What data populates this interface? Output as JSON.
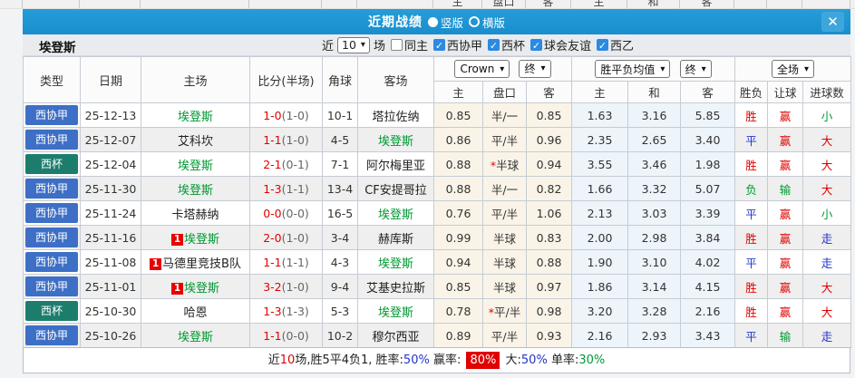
{
  "colors": {
    "title_bar": "#1a8ecd",
    "league_badge_blue": "#3e6fc6",
    "cup_badge_teal": "#1c7d6d",
    "win_red": "#e10000",
    "draw_blue": "#2233cc",
    "lose_green": "#009933",
    "team_green": "#009933",
    "odds_col_bg": "#faf4e8",
    "avg_col_bg": "#edf4fa"
  },
  "top_strip": {
    "labels": [
      "主",
      "盘口",
      "客",
      "主",
      "和",
      "客"
    ]
  },
  "titlebar": {
    "title": "近期战绩",
    "options": [
      {
        "label": "竖版",
        "selected": true
      },
      {
        "label": "横版",
        "selected": false
      }
    ],
    "close_label": "✕"
  },
  "filter": {
    "team": "埃登斯",
    "near_label": "近",
    "count_value": "10",
    "games_label": "场",
    "same_home_label": "同主",
    "leagues": [
      "西协甲",
      "西杯",
      "球会友谊",
      "西乙"
    ]
  },
  "table": {
    "selects": {
      "bookmaker": "Crown",
      "bookmaker_state": "终",
      "avg_type": "胜平负均值",
      "avg_state": "终",
      "scope": "全场"
    },
    "columns": [
      "类型",
      "日期",
      "主场",
      "比分(半场)",
      "角球",
      "客场",
      "主",
      "盘口",
      "客",
      "主",
      "和",
      "客",
      "胜负",
      "让球",
      "进球数"
    ],
    "rows": [
      {
        "league": {
          "text": "西协甲",
          "type": "lga"
        },
        "date": "25-12-13",
        "home": {
          "text": "埃登斯",
          "green": true,
          "badge": null
        },
        "score": {
          "full": "1-0",
          "half": "(1-0)"
        },
        "corner": "10-1",
        "away": {
          "text": "塔拉佐纳",
          "green": false
        },
        "odds": {
          "home": "0.85",
          "handicap": "半/一",
          "star": false,
          "away": "0.85"
        },
        "avg": [
          "1.63",
          "3.16",
          "5.85"
        ],
        "result": {
          "text": "胜",
          "color": "red"
        },
        "handicap_result": {
          "text": "赢",
          "color": "red"
        },
        "goals": {
          "text": "小",
          "color": "green"
        }
      },
      {
        "league": {
          "text": "西协甲",
          "type": "lga"
        },
        "date": "25-12-07",
        "home": {
          "text": "艾科坎",
          "green": false,
          "badge": null
        },
        "score": {
          "full": "1-1",
          "half": "(1-0)"
        },
        "corner": "4-5",
        "away": {
          "text": "埃登斯",
          "green": true
        },
        "odds": {
          "home": "0.86",
          "handicap": "平/半",
          "star": false,
          "away": "0.96"
        },
        "avg": [
          "2.35",
          "2.65",
          "3.40"
        ],
        "result": {
          "text": "平",
          "color": "blue"
        },
        "handicap_result": {
          "text": "赢",
          "color": "red"
        },
        "goals": {
          "text": "大",
          "color": "red"
        }
      },
      {
        "league": {
          "text": "西杯",
          "type": "cup"
        },
        "date": "25-12-04",
        "home": {
          "text": "埃登斯",
          "green": true,
          "badge": null
        },
        "score": {
          "full": "2-1",
          "half": "(0-1)"
        },
        "corner": "7-1",
        "away": {
          "text": "阿尔梅里亚",
          "green": false
        },
        "odds": {
          "home": "0.88",
          "handicap": "半球",
          "star": true,
          "away": "0.94"
        },
        "avg": [
          "3.55",
          "3.46",
          "1.98"
        ],
        "result": {
          "text": "胜",
          "color": "red"
        },
        "handicap_result": {
          "text": "赢",
          "color": "red"
        },
        "goals": {
          "text": "大",
          "color": "red"
        }
      },
      {
        "league": {
          "text": "西协甲",
          "type": "lga"
        },
        "date": "25-11-30",
        "home": {
          "text": "埃登斯",
          "green": true,
          "badge": null
        },
        "score": {
          "full": "1-3",
          "half": "(1-1)"
        },
        "corner": "13-4",
        "away": {
          "text": "CF安提哥拉",
          "green": false
        },
        "odds": {
          "home": "0.88",
          "handicap": "半/一",
          "star": false,
          "away": "0.82"
        },
        "avg": [
          "1.66",
          "3.32",
          "5.07"
        ],
        "result": {
          "text": "负",
          "color": "green"
        },
        "handicap_result": {
          "text": "输",
          "color": "green"
        },
        "goals": {
          "text": "大",
          "color": "red"
        }
      },
      {
        "league": {
          "text": "西协甲",
          "type": "lga"
        },
        "date": "25-11-24",
        "home": {
          "text": "卡塔赫纳",
          "green": false,
          "badge": null
        },
        "score": {
          "full": "0-0",
          "half": "(0-0)"
        },
        "corner": "16-5",
        "away": {
          "text": "埃登斯",
          "green": true
        },
        "odds": {
          "home": "0.76",
          "handicap": "平/半",
          "star": false,
          "away": "1.06"
        },
        "avg": [
          "2.13",
          "3.03",
          "3.39"
        ],
        "result": {
          "text": "平",
          "color": "blue"
        },
        "handicap_result": {
          "text": "赢",
          "color": "red"
        },
        "goals": {
          "text": "小",
          "color": "green"
        }
      },
      {
        "league": {
          "text": "西协甲",
          "type": "lga"
        },
        "date": "25-11-16",
        "home": {
          "text": "埃登斯",
          "green": true,
          "badge": "1"
        },
        "score": {
          "full": "2-0",
          "half": "(1-0)"
        },
        "corner": "3-4",
        "away": {
          "text": "赫库斯",
          "green": false
        },
        "odds": {
          "home": "0.99",
          "handicap": "半球",
          "star": false,
          "away": "0.83"
        },
        "avg": [
          "2.00",
          "2.98",
          "3.84"
        ],
        "result": {
          "text": "胜",
          "color": "red"
        },
        "handicap_result": {
          "text": "赢",
          "color": "red"
        },
        "goals": {
          "text": "走",
          "color": "blue"
        }
      },
      {
        "league": {
          "text": "西协甲",
          "type": "lga"
        },
        "date": "25-11-08",
        "home": {
          "text": "马德里竞技B队",
          "green": false,
          "badge": "1"
        },
        "score": {
          "full": "1-1",
          "half": "(1-1)"
        },
        "corner": "4-3",
        "away": {
          "text": "埃登斯",
          "green": true
        },
        "odds": {
          "home": "0.94",
          "handicap": "半球",
          "star": false,
          "away": "0.88"
        },
        "avg": [
          "1.90",
          "3.10",
          "4.02"
        ],
        "result": {
          "text": "平",
          "color": "blue"
        },
        "handicap_result": {
          "text": "赢",
          "color": "red"
        },
        "goals": {
          "text": "走",
          "color": "blue"
        }
      },
      {
        "league": {
          "text": "西协甲",
          "type": "lga"
        },
        "date": "25-11-01",
        "home": {
          "text": "埃登斯",
          "green": true,
          "badge": "1"
        },
        "score": {
          "full": "3-2",
          "half": "(1-0)"
        },
        "corner": "9-4",
        "away": {
          "text": "艾基史拉斯",
          "green": false
        },
        "odds": {
          "home": "0.85",
          "handicap": "半球",
          "star": false,
          "away": "0.97"
        },
        "avg": [
          "1.86",
          "3.14",
          "4.15"
        ],
        "result": {
          "text": "胜",
          "color": "red"
        },
        "handicap_result": {
          "text": "赢",
          "color": "red"
        },
        "goals": {
          "text": "大",
          "color": "red"
        }
      },
      {
        "league": {
          "text": "西杯",
          "type": "cup"
        },
        "date": "25-10-30",
        "home": {
          "text": "哈恩",
          "green": false,
          "badge": null
        },
        "score": {
          "full": "1-3",
          "half": "(1-3)"
        },
        "corner": "5-3",
        "away": {
          "text": "埃登斯",
          "green": true
        },
        "odds": {
          "home": "0.78",
          "handicap": "平/半",
          "star": true,
          "away": "0.98"
        },
        "avg": [
          "3.20",
          "3.28",
          "2.16"
        ],
        "result": {
          "text": "胜",
          "color": "red"
        },
        "handicap_result": {
          "text": "赢",
          "color": "red"
        },
        "goals": {
          "text": "大",
          "color": "red"
        }
      },
      {
        "league": {
          "text": "西协甲",
          "type": "lga"
        },
        "date": "25-10-26",
        "home": {
          "text": "埃登斯",
          "green": true,
          "badge": null
        },
        "score": {
          "full": "1-1",
          "half": "(0-0)"
        },
        "corner": "10-2",
        "away": {
          "text": "穆尔西亚",
          "green": false
        },
        "odds": {
          "home": "0.89",
          "handicap": "平/半",
          "star": false,
          "away": "0.93"
        },
        "avg": [
          "2.16",
          "2.93",
          "3.43"
        ],
        "result": {
          "text": "平",
          "color": "blue"
        },
        "handicap_result": {
          "text": "输",
          "color": "green"
        },
        "goals": {
          "text": "走",
          "color": "blue"
        }
      }
    ]
  },
  "summary": {
    "parts": [
      {
        "text": "近",
        "style": "plain"
      },
      {
        "text": "10",
        "style": "red"
      },
      {
        "text": "场,胜5平4负1, 胜率:",
        "style": "plain"
      },
      {
        "text": "50%",
        "style": "blue"
      },
      {
        "text": " 赢率: ",
        "style": "plain"
      },
      {
        "text": "80%",
        "style": "redbg"
      },
      {
        "text": " 大:",
        "style": "plain"
      },
      {
        "text": "50%",
        "style": "blue"
      },
      {
        "text": " 单率:",
        "style": "plain"
      },
      {
        "text": "30%",
        "style": "green"
      }
    ]
  }
}
